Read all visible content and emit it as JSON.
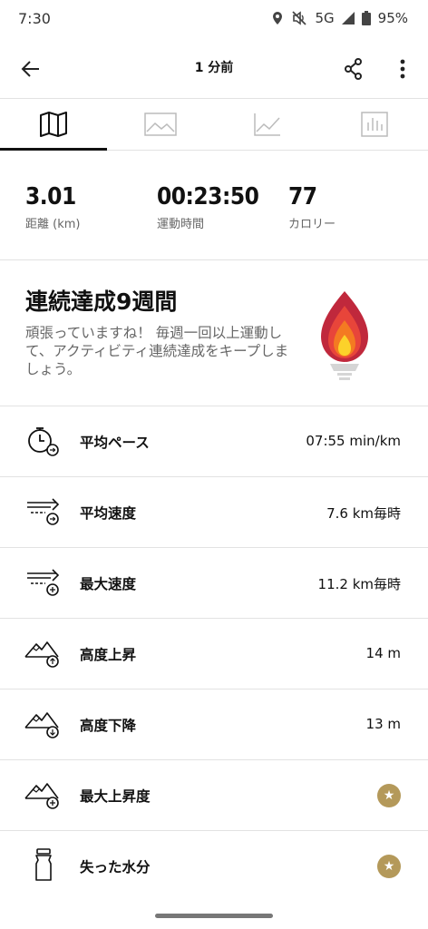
{
  "status_bar": {
    "time": "7:30",
    "network": "5G",
    "battery": "95%"
  },
  "header": {
    "title": "1 分前"
  },
  "stats": [
    {
      "value": "3.01",
      "label": "距離 (km)"
    },
    {
      "value": "00:23:50",
      "label": "運動時間"
    },
    {
      "value": "77",
      "label": "カロリー"
    }
  ],
  "streak": {
    "title": "連続達成9週間",
    "description": "頑張っていますね！ 毎週一回以上運動して、アクティビティ連続達成をキープしましょう。"
  },
  "metrics": [
    {
      "label": "平均ペース",
      "value": "07:55 min/km",
      "icon": "stopwatch-icon"
    },
    {
      "label": "平均速度",
      "value": "7.6 km毎時",
      "icon": "speed-average-icon"
    },
    {
      "label": "最大速度",
      "value": "11.2 km毎時",
      "icon": "speed-max-icon"
    },
    {
      "label": "高度上昇",
      "value": "14 m",
      "icon": "elevation-up-icon"
    },
    {
      "label": "高度下降",
      "value": "13 m",
      "icon": "elevation-down-icon"
    },
    {
      "label": "最大上昇度",
      "value": "",
      "icon": "elevation-max-icon",
      "premium": true
    },
    {
      "label": "失った水分",
      "value": "",
      "icon": "water-bottle-icon",
      "premium": true
    }
  ],
  "colors": {
    "premium_gold": "#b4995a",
    "flame_red": "#c0283c",
    "flame_orange": "#f47a22",
    "flame_yellow": "#fcd22a"
  }
}
